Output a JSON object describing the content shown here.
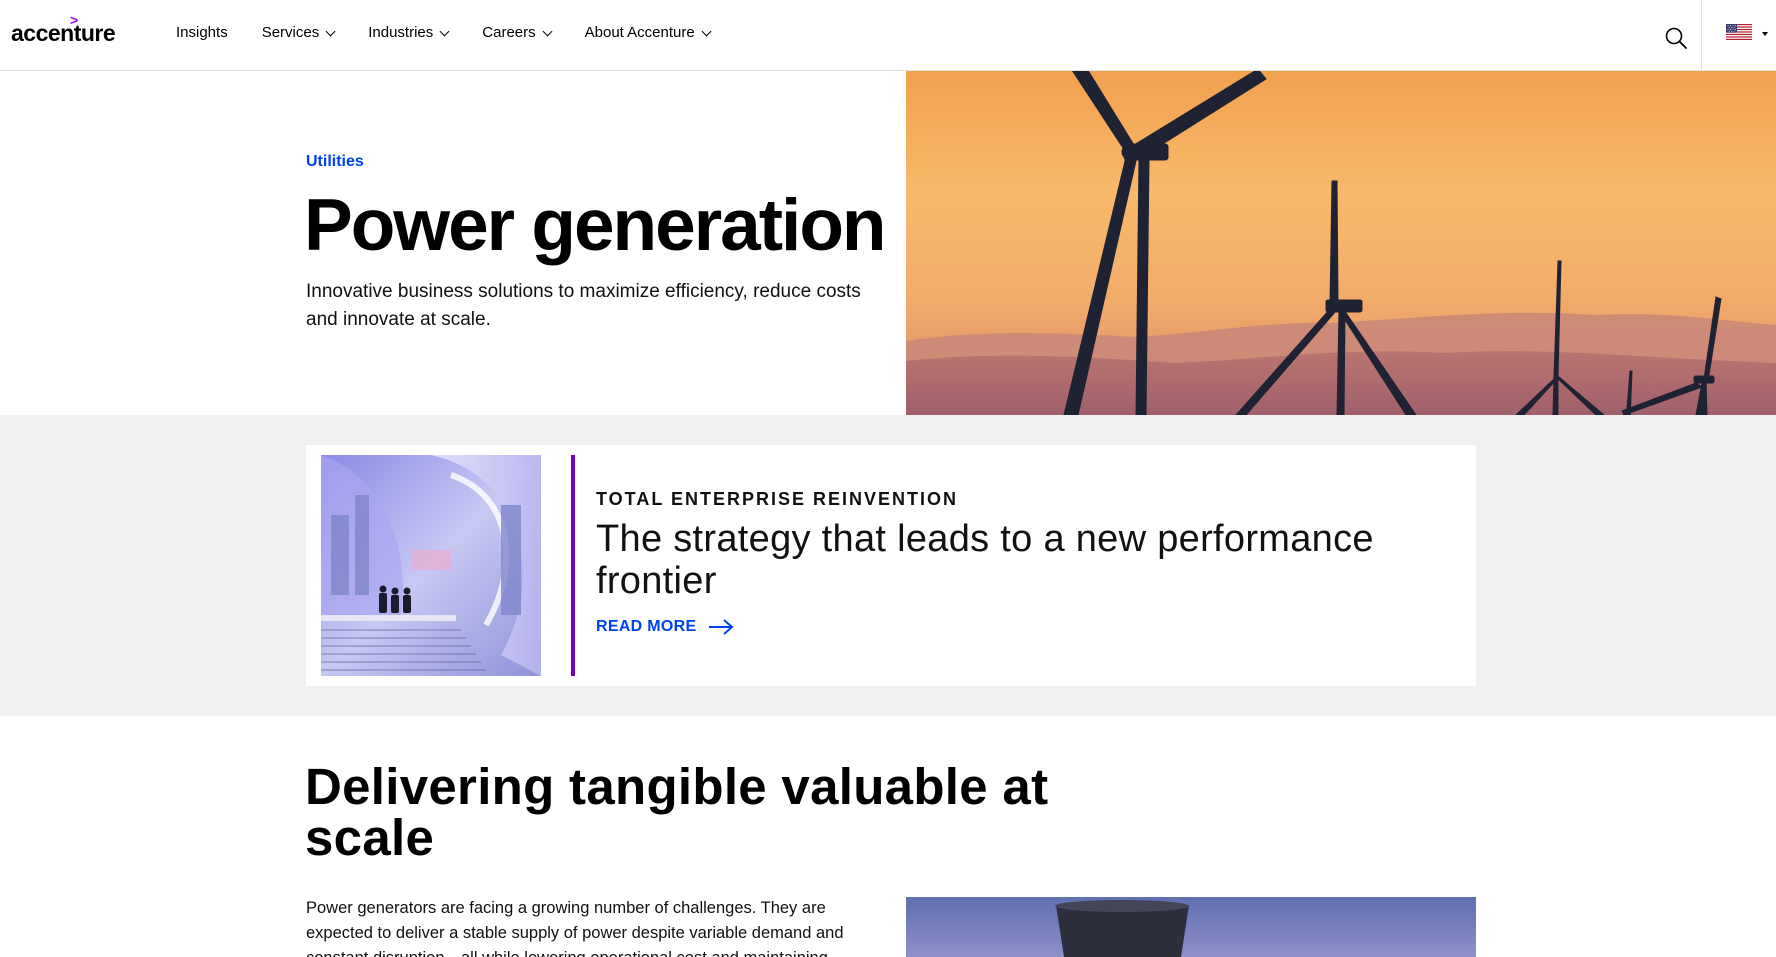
{
  "brand": {
    "logo_text": "accenture",
    "logo_mark": ">",
    "accent_color": "#a100ff",
    "link_color": "#0041f0"
  },
  "nav": {
    "items": [
      {
        "label": "Insights",
        "has_dropdown": false
      },
      {
        "label": "Services",
        "has_dropdown": true
      },
      {
        "label": "Industries",
        "has_dropdown": true
      },
      {
        "label": "Careers",
        "has_dropdown": true
      },
      {
        "label": "About Accenture",
        "has_dropdown": true
      }
    ],
    "search_icon": "search-icon",
    "locale_icon": "us-flag-icon"
  },
  "hero": {
    "eyebrow": "Utilities",
    "title": "Power generation",
    "description": "Innovative business solutions to maximize efficiency, reduce costs and innovate at scale.",
    "image": "wind-turbines-sunset"
  },
  "promo": {
    "eyebrow": "TOTAL ENTERPRISE REINVENTION",
    "title": "The strategy that leads to a new performance frontier",
    "link_label": "READ MORE",
    "image": "futuristic-architecture-people",
    "bar_color": "#7500c0",
    "band_color": "#f1f1f1"
  },
  "section": {
    "title": "Delivering tangible valuable at scale",
    "body": "Power generators are facing a growing number of challenges. They are expected to deliver a stable supply of power despite variable demand and constant disruption—all while lowering operational cost and maintaining",
    "image": "cooling-tower"
  }
}
